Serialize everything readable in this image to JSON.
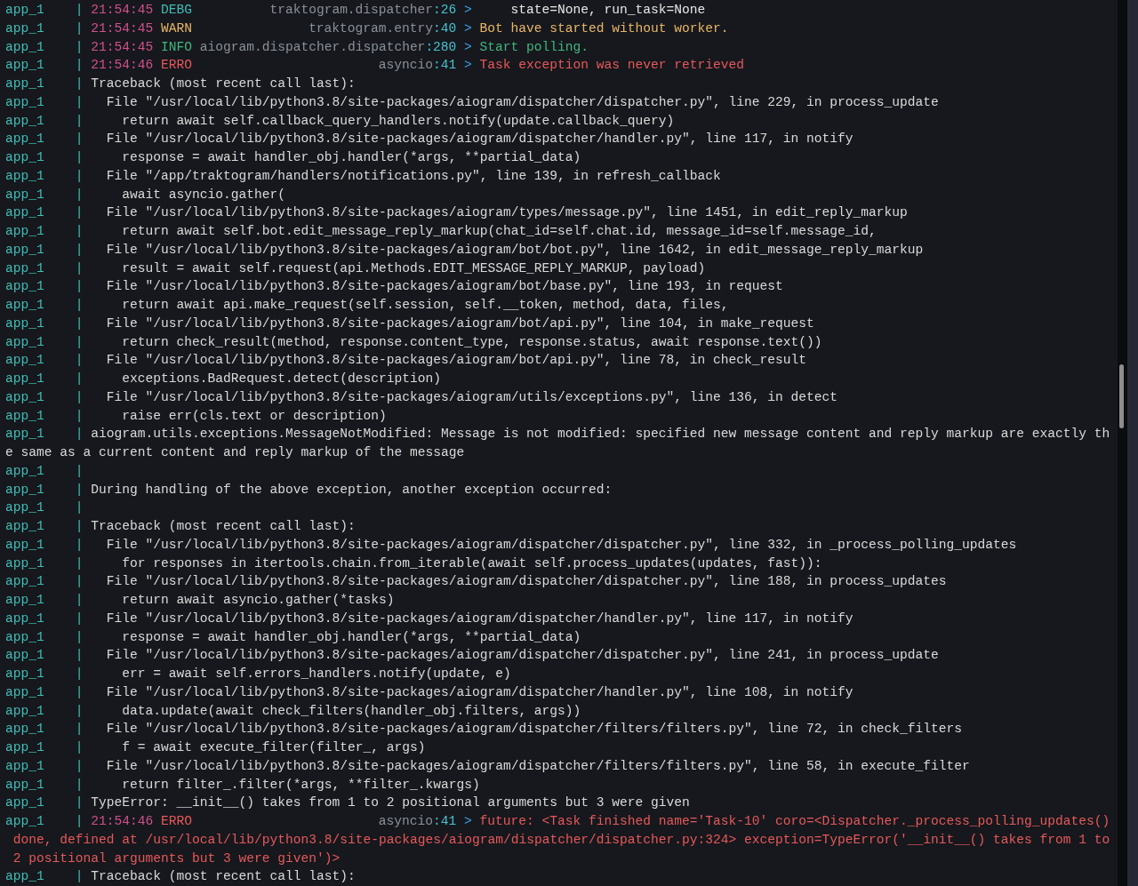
{
  "terminal": {
    "lines": [
      {
        "kind": "log",
        "app": "app_1",
        "sep": "|",
        "time": "21:54:45",
        "tag": {
          "text": "DEBG",
          "color": "#3fbdb5"
        },
        "source": "traktogram.dispatcher",
        "lineno": ":26",
        "arrow": ">",
        "message": {
          "text": "    state=None, run_task=None",
          "color": "#e6e6e6"
        }
      },
      {
        "kind": "log",
        "app": "app_1",
        "sep": "|",
        "time": "21:54:45",
        "tag": {
          "text": "WARN",
          "color": "#e8b665"
        },
        "source": "traktogram.entry",
        "lineno": ":40",
        "arrow": ">",
        "message": {
          "text": "Bot have started without worker.",
          "color": "#e8b665"
        }
      },
      {
        "kind": "log",
        "app": "app_1",
        "sep": "|",
        "time": "21:54:45",
        "tag": {
          "text": "INFO",
          "color": "#40b77c"
        },
        "source": "aiogram.dispatcher.dispatcher",
        "lineno": ":280",
        "arrow": ">",
        "message": {
          "text": "Start polling.",
          "color": "#40b77c"
        }
      },
      {
        "kind": "log",
        "app": "app_1",
        "sep": "|",
        "time": "21:54:46",
        "tag": {
          "text": "ERRO",
          "color": "#e5585a"
        },
        "source": "asyncio",
        "lineno": ":41",
        "arrow": ">",
        "message": {
          "text": "Task exception was never retrieved",
          "color": "#e5585a"
        }
      },
      {
        "kind": "text",
        "app": "app_1",
        "sep": "|",
        "text": "Traceback (most recent call last):"
      },
      {
        "kind": "text",
        "app": "app_1",
        "sep": "|",
        "text": "  File \"/usr/local/lib/python3.8/site-packages/aiogram/dispatcher/dispatcher.py\", line 229, in process_update"
      },
      {
        "kind": "text",
        "app": "app_1",
        "sep": "|",
        "text": "    return await self.callback_query_handlers.notify(update.callback_query)"
      },
      {
        "kind": "text",
        "app": "app_1",
        "sep": "|",
        "text": "  File \"/usr/local/lib/python3.8/site-packages/aiogram/dispatcher/handler.py\", line 117, in notify"
      },
      {
        "kind": "text",
        "app": "app_1",
        "sep": "|",
        "text": "    response = await handler_obj.handler(*args, **partial_data)"
      },
      {
        "kind": "text",
        "app": "app_1",
        "sep": "|",
        "text": "  File \"/app/traktogram/handlers/notifications.py\", line 139, in refresh_callback"
      },
      {
        "kind": "text",
        "app": "app_1",
        "sep": "|",
        "text": "    await asyncio.gather("
      },
      {
        "kind": "text",
        "app": "app_1",
        "sep": "|",
        "text": "  File \"/usr/local/lib/python3.8/site-packages/aiogram/types/message.py\", line 1451, in edit_reply_markup"
      },
      {
        "kind": "text",
        "app": "app_1",
        "sep": "|",
        "text": "    return await self.bot.edit_message_reply_markup(chat_id=self.chat.id, message_id=self.message_id,"
      },
      {
        "kind": "text",
        "app": "app_1",
        "sep": "|",
        "text": "  File \"/usr/local/lib/python3.8/site-packages/aiogram/bot/bot.py\", line 1642, in edit_message_reply_markup"
      },
      {
        "kind": "text",
        "app": "app_1",
        "sep": "|",
        "text": "    result = await self.request(api.Methods.EDIT_MESSAGE_REPLY_MARKUP, payload)"
      },
      {
        "kind": "text",
        "app": "app_1",
        "sep": "|",
        "text": "  File \"/usr/local/lib/python3.8/site-packages/aiogram/bot/base.py\", line 193, in request"
      },
      {
        "kind": "text",
        "app": "app_1",
        "sep": "|",
        "text": "    return await api.make_request(self.session, self.__token, method, data, files,"
      },
      {
        "kind": "text",
        "app": "app_1",
        "sep": "|",
        "text": "  File \"/usr/local/lib/python3.8/site-packages/aiogram/bot/api.py\", line 104, in make_request"
      },
      {
        "kind": "text",
        "app": "app_1",
        "sep": "|",
        "text": "    return check_result(method, response.content_type, response.status, await response.text())"
      },
      {
        "kind": "text",
        "app": "app_1",
        "sep": "|",
        "text": "  File \"/usr/local/lib/python3.8/site-packages/aiogram/bot/api.py\", line 78, in check_result"
      },
      {
        "kind": "text",
        "app": "app_1",
        "sep": "|",
        "text": "    exceptions.BadRequest.detect(description)"
      },
      {
        "kind": "text",
        "app": "app_1",
        "sep": "|",
        "text": "  File \"/usr/local/lib/python3.8/site-packages/aiogram/utils/exceptions.py\", line 136, in detect"
      },
      {
        "kind": "text",
        "app": "app_1",
        "sep": "|",
        "text": "    raise err(cls.text or description)"
      },
      {
        "kind": "text",
        "app": "app_1",
        "sep": "|",
        "text": "aiogram.utils.exceptions.MessageNotModified: Message is not modified: specified new message content and reply markup are exactly th"
      },
      {
        "kind": "wrap",
        "color": "#d9d9d9",
        "text": "e same as a current content and reply markup of the message"
      },
      {
        "kind": "text",
        "app": "app_1",
        "sep": "|"
      },
      {
        "kind": "text",
        "app": "app_1",
        "sep": "|",
        "text": "During handling of the above exception, another exception occurred:"
      },
      {
        "kind": "text",
        "app": "app_1",
        "sep": "|"
      },
      {
        "kind": "text",
        "app": "app_1",
        "sep": "|",
        "text": "Traceback (most recent call last):"
      },
      {
        "kind": "text",
        "app": "app_1",
        "sep": "|",
        "text": "  File \"/usr/local/lib/python3.8/site-packages/aiogram/dispatcher/dispatcher.py\", line 332, in _process_polling_updates"
      },
      {
        "kind": "text",
        "app": "app_1",
        "sep": "|",
        "text": "    for responses in itertools.chain.from_iterable(await self.process_updates(updates, fast)):"
      },
      {
        "kind": "text",
        "app": "app_1",
        "sep": "|",
        "text": "  File \"/usr/local/lib/python3.8/site-packages/aiogram/dispatcher/dispatcher.py\", line 188, in process_updates"
      },
      {
        "kind": "text",
        "app": "app_1",
        "sep": "|",
        "text": "    return await asyncio.gather(*tasks)"
      },
      {
        "kind": "text",
        "app": "app_1",
        "sep": "|",
        "text": "  File \"/usr/local/lib/python3.8/site-packages/aiogram/dispatcher/handler.py\", line 117, in notify"
      },
      {
        "kind": "text",
        "app": "app_1",
        "sep": "|",
        "text": "    response = await handler_obj.handler(*args, **partial_data)"
      },
      {
        "kind": "text",
        "app": "app_1",
        "sep": "|",
        "text": "  File \"/usr/local/lib/python3.8/site-packages/aiogram/dispatcher/dispatcher.py\", line 241, in process_update"
      },
      {
        "kind": "text",
        "app": "app_1",
        "sep": "|",
        "text": "    err = await self.errors_handlers.notify(update, e)"
      },
      {
        "kind": "text",
        "app": "app_1",
        "sep": "|",
        "text": "  File \"/usr/local/lib/python3.8/site-packages/aiogram/dispatcher/handler.py\", line 108, in notify"
      },
      {
        "kind": "text",
        "app": "app_1",
        "sep": "|",
        "text": "    data.update(await check_filters(handler_obj.filters, args))"
      },
      {
        "kind": "text",
        "app": "app_1",
        "sep": "|",
        "text": "  File \"/usr/local/lib/python3.8/site-packages/aiogram/dispatcher/filters/filters.py\", line 72, in check_filters"
      },
      {
        "kind": "text",
        "app": "app_1",
        "sep": "|",
        "text": "    f = await execute_filter(filter_, args)"
      },
      {
        "kind": "text",
        "app": "app_1",
        "sep": "|",
        "text": "  File \"/usr/local/lib/python3.8/site-packages/aiogram/dispatcher/filters/filters.py\", line 58, in execute_filter"
      },
      {
        "kind": "text",
        "app": "app_1",
        "sep": "|",
        "text": "    return filter_.filter(*args, **filter_.kwargs)"
      },
      {
        "kind": "text",
        "app": "app_1",
        "sep": "|",
        "text": "TypeError: __init__() takes from 1 to 2 positional arguments but 3 were given"
      },
      {
        "kind": "log",
        "app": "app_1",
        "sep": "|",
        "time": "21:54:46",
        "tag": {
          "text": "ERRO",
          "color": "#e5585a"
        },
        "source": "asyncio",
        "lineno": ":41",
        "arrow": ">",
        "message": {
          "text": "future: <Task finished name='Task-10' coro=<Dispatcher._process_polling_updates()",
          "color": "#e5585a"
        }
      },
      {
        "kind": "wrap",
        "color": "#e5585a",
        "text": " done, defined at /usr/local/lib/python3.8/site-packages/aiogram/dispatcher/dispatcher.py:324> exception=TypeError('__init__() takes from 1 to"
      },
      {
        "kind": "wrap",
        "color": "#e5585a",
        "text": " 2 positional arguments but 3 were given')>"
      },
      {
        "kind": "text",
        "app": "app_1",
        "sep": "|",
        "text": "Traceback (most recent call last):"
      }
    ]
  }
}
